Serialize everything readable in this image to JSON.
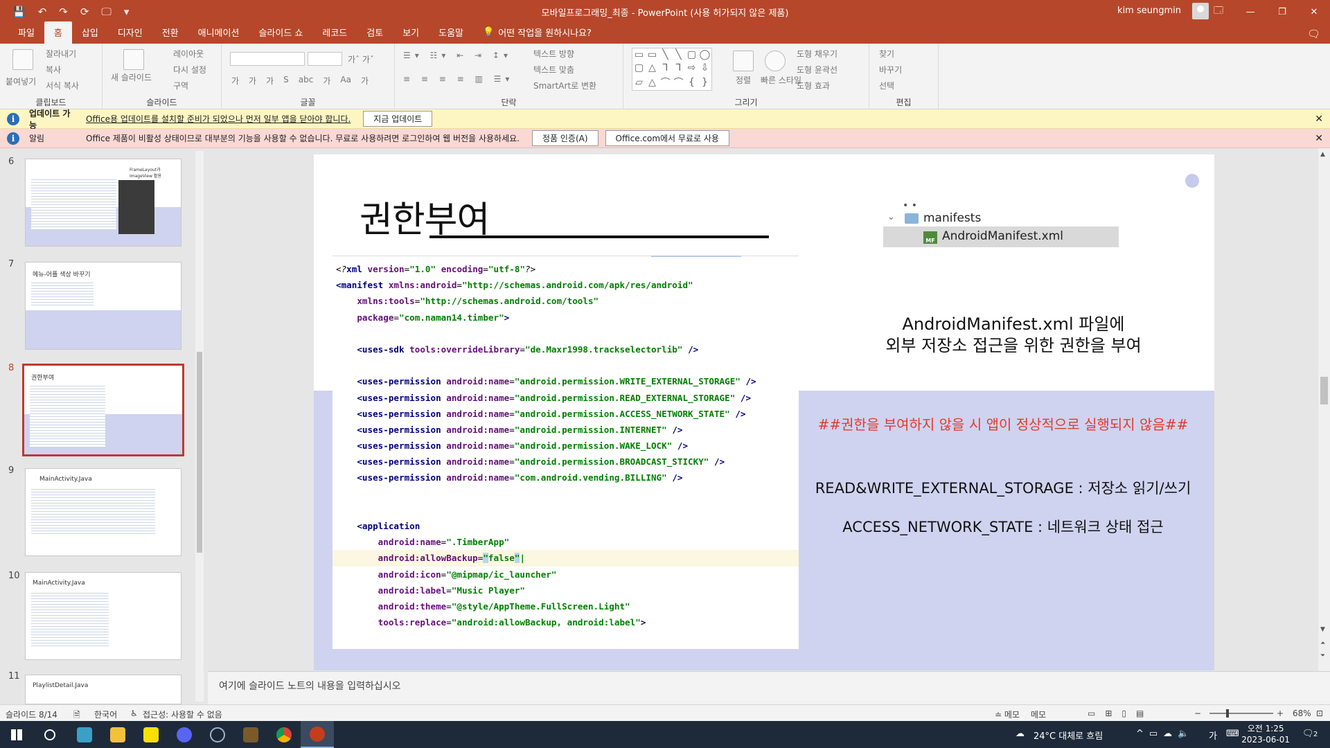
{
  "titlebar": {
    "doc_title": "모바일프로그래밍_최종  -  PowerPoint (사용 허가되지 않은 제품)",
    "user": "kim seungmin",
    "qat": [
      "💾",
      "↶",
      "↷",
      "⟳",
      "🖵",
      "▾"
    ],
    "win": [
      "🗔",
      "—",
      "❐",
      "✕"
    ]
  },
  "tabs": [
    "파일",
    "홈",
    "삽입",
    "디자인",
    "전환",
    "애니메이션",
    "슬라이드 쇼",
    "레코드",
    "검토",
    "보기",
    "도움말"
  ],
  "tellme": "어떤 작업을 원하시나요?",
  "ribbon": {
    "groups": {
      "clipboard": "클립보드",
      "slides": "슬라이드",
      "font": "글꼴",
      "paragraph": "단락",
      "drawing": "그리기",
      "editing": "편집"
    },
    "paste": "붙여넣기",
    "cut": "잘라내기",
    "copy": "복사",
    "format_painter": "서식 복사",
    "new_slide": "새 슬라이드",
    "layout": "레이아웃",
    "reset": "다시 설정",
    "section": "구역",
    "text_direction": "텍스트 방향",
    "align_text": "텍스트 맞춤",
    "smartart": "SmartArt로 변환",
    "arrange": "정렬",
    "quick_styles": "빠른 스타일",
    "shape_fill": "도형 채우기",
    "shape_outline": "도형 윤곽선",
    "shape_effects": "도형 효과",
    "find": "찾기",
    "replace": "바꾸기",
    "select": "선택",
    "font_buttons": [
      "가",
      "가",
      "가",
      "S",
      "abc",
      "가",
      "Aa",
      "가"
    ]
  },
  "bars": {
    "update": {
      "name": "업데이트 가능",
      "msg": "Office용 업데이트를 설치할 준비가 되었으나 먼저 일부 앱을 닫아야 합니다.",
      "button": "지금 업데이트"
    },
    "notice": {
      "name": "알림",
      "msg": "Office 제품이 비활성 상태이므로 대부분의 기능을 사용할 수 없습니다. 무료로 사용하려면 로그인하여 웹 버전을 사용하세요.",
      "button1": "정품 인증(A)",
      "button2": "Office.com에서 무료로 사용"
    }
  },
  "thumbs": [
    {
      "num": "6",
      "title": "FrameLayout과 ImageView 활용"
    },
    {
      "num": "7",
      "title": "메뉴-어플 색상 바꾸기"
    },
    {
      "num": "8",
      "title": "권한부여"
    },
    {
      "num": "9",
      "title": "MainActivity.Java"
    },
    {
      "num": "10",
      "title": "MainActivity.Java"
    },
    {
      "num": "11",
      "title": "PlaylistDetail.Java"
    }
  ],
  "slide": {
    "title": "권한부여",
    "tree_dots": "• •",
    "tree_folder": "manifests",
    "tree_file": "AndroidManifest.xml",
    "mf": "MF",
    "desc": [
      "AndroidManifest.xml 파일에",
      "외부 저장소 접근을 위한 권한을 부여"
    ],
    "warn": "##권한을 부여하지 않을 시 앱이 정상적으로 실행되지 않음##",
    "perm1": "READ&WRITE_EXTERNAL_STORAGE : 저장소 읽기/쓰기",
    "perm2": "ACCESS_NETWORK_STATE : 네트워크 상태 접근"
  },
  "code": {
    "xmlver": "\"1.0\"",
    "enc": "\"utf-8\"",
    "xmlns": "\"http://schemas.android.com/apk/res/android\"",
    "tools": "\"http://schemas.android.com/tools\"",
    "package": "\"com.naman14.timber\"",
    "overridelib": "\"de.Maxr1998.trackselectorlib\"",
    "perms": [
      "\"android.permission.WRITE_EXTERNAL_STORAGE\"",
      "\"android.permission.READ_EXTERNAL_STORAGE\"",
      "\"android.permission.ACCESS_NETWORK_STATE\"",
      "\"android.permission.INTERNET\"",
      "\"android.permission.WAKE_LOCK\"",
      "\"android.permission.BROADCAST_STICKY\"",
      "\"com.android.vending.BILLING\""
    ],
    "appname": "\".TimberApp\"",
    "allowbackup": "false",
    "icon": "\"@mipmap/ic_launcher\"",
    "label": "\"Music Player\"",
    "theme": "\"@style/AppTheme.FullScreen.Light\"",
    "replace": "\"android:allowBackup, android:label\""
  },
  "notes_placeholder": "여기에 슬라이드 노트의 내용을 입력하십시오",
  "status": {
    "slide": "슬라이드 8/14",
    "lang": "한국어",
    "access": "접근성: 사용할 수 없음",
    "notes1": "≐ 메모",
    "notes2": "메모",
    "zoom": "68%"
  },
  "taskbar": {
    "weather": "24°C 대체로 흐림",
    "time": "오전 1:25",
    "date": "2023-06-01",
    "ime": "가",
    "notif": "2"
  }
}
